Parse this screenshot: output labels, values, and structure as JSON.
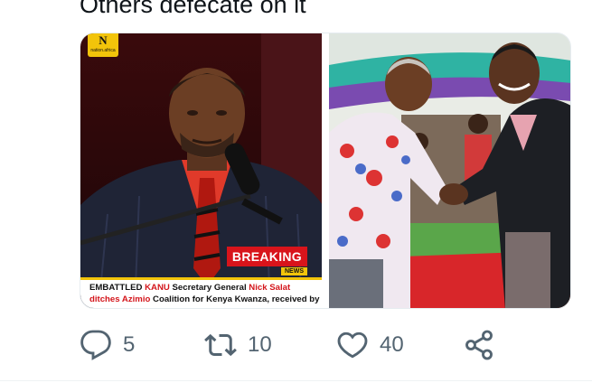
{
  "tweet": {
    "text": "Others defecate on it"
  },
  "media": [
    {
      "logo_text": "N",
      "logo_sub": "nation.africa",
      "breaking_label": "BREAKING",
      "news_label": "NEWS",
      "caption_line1_a": "EMBATTLED ",
      "caption_line1_b": "KANU",
      "caption_line1_c": " Secretary General ",
      "caption_line1_d": "Nick Salat",
      "caption_line2_a": "ditches ",
      "caption_line2_b": "Azimio",
      "caption_line2_c": " Coalition for Kenya Kwanza, received by"
    },
    {}
  ],
  "actions": {
    "reply_count": "5",
    "retweet_count": "10",
    "like_count": "40"
  },
  "icons": [
    "reply-icon",
    "retweet-icon",
    "like-icon",
    "share-icon"
  ],
  "colors": {
    "action_gray": "#536471",
    "breaking_red": "#d8141b",
    "accent_yellow": "#f2c40a"
  }
}
